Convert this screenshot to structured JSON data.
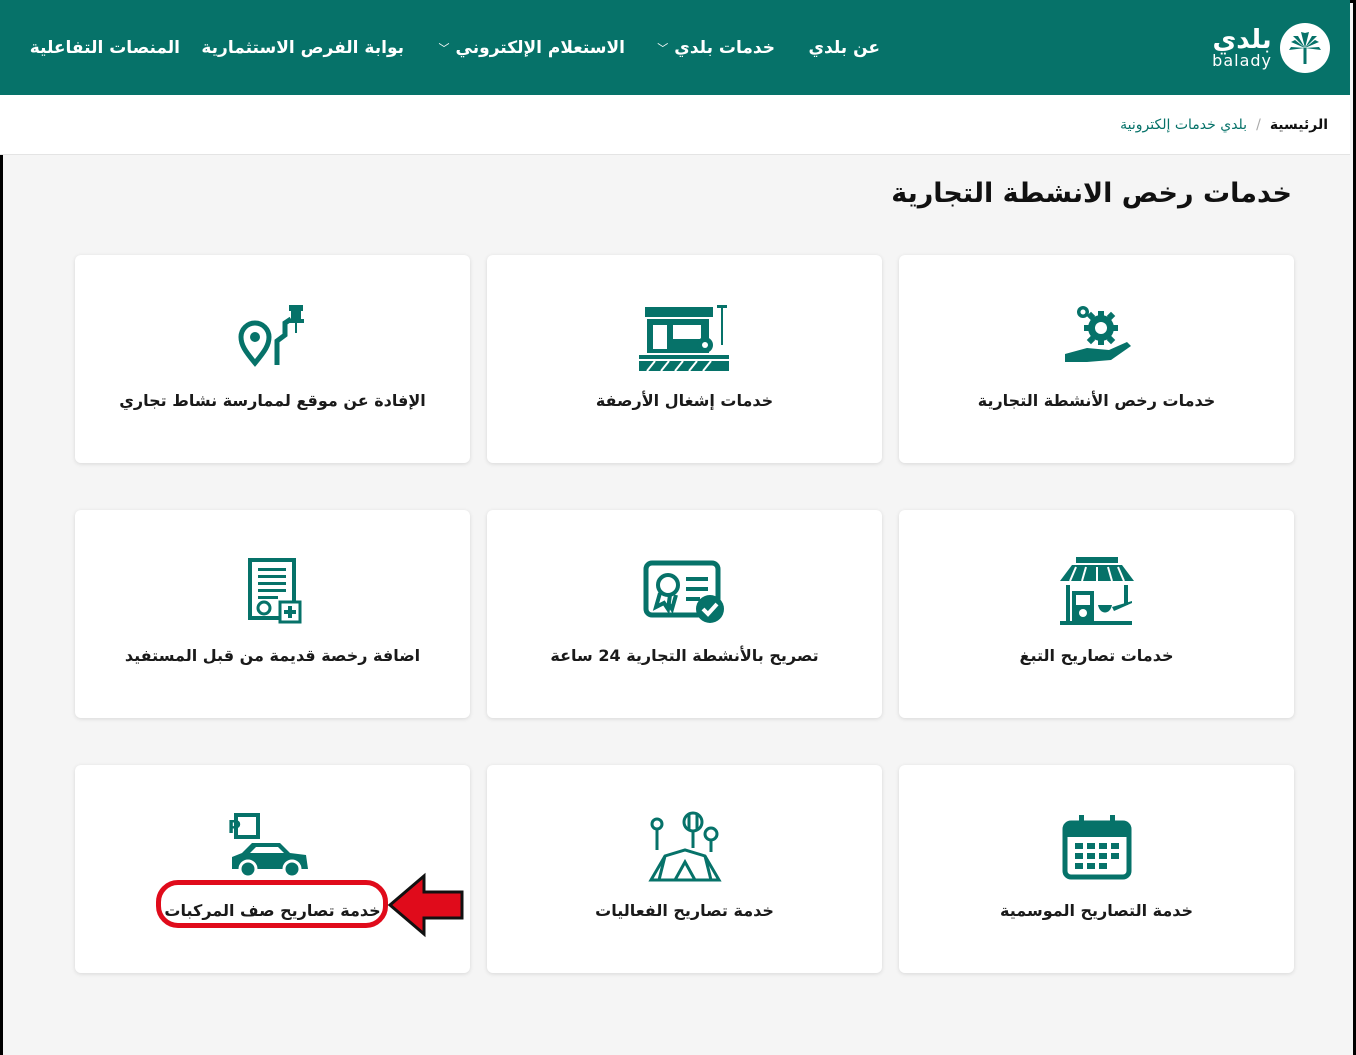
{
  "brand": {
    "logo_ar": "بلدي",
    "logo_en": "balady",
    "color": "#067269"
  },
  "nav": {
    "items": [
      {
        "label": "عن بلدي",
        "dropdown": false
      },
      {
        "label": "خدمات بلدي",
        "dropdown": true
      },
      {
        "label": "الاستعلام الإلكتروني",
        "dropdown": true
      },
      {
        "label": "بوابة الفرص الاستثمارية",
        "dropdown": false
      },
      {
        "label": "المنصات التفاعلية",
        "dropdown": false
      }
    ]
  },
  "breadcrumb": {
    "home": "الرئيسية",
    "separator": "/",
    "current": "بلدي خدمات إلكترونية"
  },
  "page": {
    "title": "خدمات رخص الانشطة التجارية"
  },
  "cards": [
    {
      "label": "خدمات رخص الأنشطة التجارية",
      "icon": "gear-hand-icon"
    },
    {
      "label": "خدمات إشغال الأرصفة",
      "icon": "storefront-icon"
    },
    {
      "label": "الإفادة عن موقع لممارسة نشاط تجاري",
      "icon": "location-pin-path-icon"
    },
    {
      "label": "خدمات تصاريح التبغ",
      "icon": "tobacco-shop-icon"
    },
    {
      "label": "تصريح بالأنشطة التجارية 24 ساعة",
      "icon": "certificate-check-icon"
    },
    {
      "label": "اضافة رخصة قديمة من قبل المستفيد",
      "icon": "document-add-icon"
    },
    {
      "label": "خدمة التصاريح الموسمية",
      "icon": "calendar-icon"
    },
    {
      "label": "خدمة تصاريح الفعاليات",
      "icon": "event-tent-icon"
    },
    {
      "label": "خدمة تصاريح صف المركبات",
      "icon": "parking-car-icon"
    }
  ],
  "annotation": {
    "highlight_color": "#e00b1b"
  }
}
